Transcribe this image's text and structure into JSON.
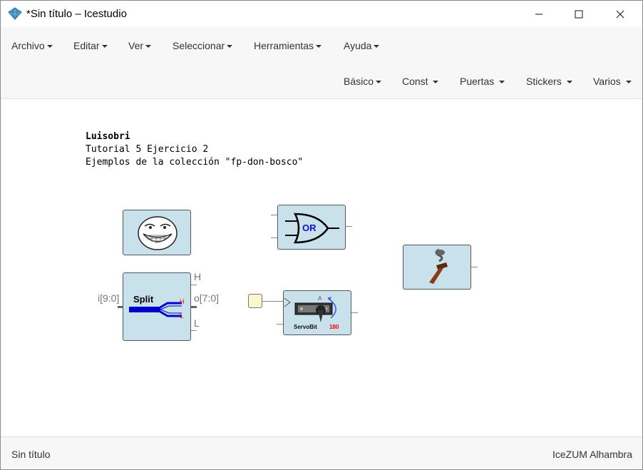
{
  "window": {
    "title": "*Sin título – Icestudio"
  },
  "menu": {
    "row1": [
      "Archivo",
      "Editar",
      "Ver",
      "Seleccionar",
      "Herramientas",
      "Ayuda"
    ],
    "row2": [
      "Básico",
      "Const",
      "Puertas",
      "Stickers",
      "Varios"
    ]
  },
  "canvas": {
    "comment": {
      "line1": "Luisobri",
      "line2": "Tutorial 5 Ejercicio 2",
      "line3": "Ejemplos de la colección \"fp-don-bosco\""
    },
    "or_gate": {
      "label": "OR"
    },
    "split": {
      "title": "Split",
      "input_label": "i[9:0]",
      "output_label": "o[7:0]",
      "high_label": "H",
      "low_label": "L",
      "high_mark": "H",
      "low_mark": "L"
    },
    "servo": {
      "name": "ServoBit",
      "value": "180",
      "angle_mark": "A"
    }
  },
  "status": {
    "left": "Sin título",
    "right": "IceZUM Alhambra"
  },
  "colors": {
    "block_fill": "#c8e1ea",
    "canvas": "#ffffff",
    "bus": "#0000cc",
    "servo_value": "#ff0000"
  }
}
